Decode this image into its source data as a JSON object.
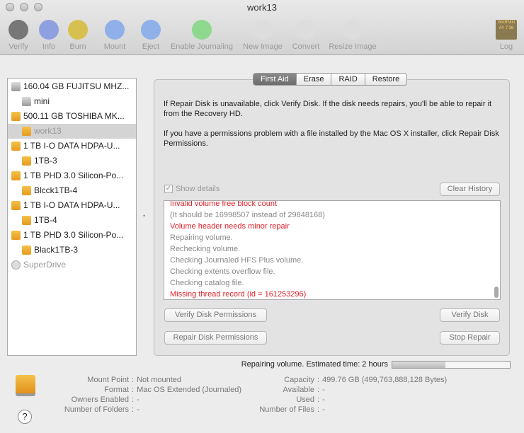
{
  "window": {
    "title": "work13"
  },
  "toolbar": {
    "items": [
      {
        "label": "Verify",
        "icon": "microscope-icon",
        "color": "#777"
      },
      {
        "label": "Info",
        "icon": "info-icon",
        "color": "#8fa0e0"
      },
      {
        "label": "Burn",
        "icon": "burn-icon",
        "color": "#d8c050"
      },
      {
        "label": "Mount",
        "icon": "mount-icon",
        "color": "#8fb0e8"
      },
      {
        "label": "Eject",
        "icon": "eject-icon",
        "color": "#8fb0e8"
      },
      {
        "label": "Enable Journaling",
        "icon": "journal-icon",
        "color": "#8fd88f"
      },
      {
        "label": "New Image",
        "icon": "new-image-icon",
        "color": "#ddd"
      },
      {
        "label": "Convert",
        "icon": "convert-icon",
        "color": "#ddd"
      },
      {
        "label": "Resize Image",
        "icon": "resize-image-icon",
        "color": "#ddd"
      }
    ],
    "log": {
      "label": "Log",
      "icon_text": "WARNIN\nAY 7:36"
    }
  },
  "sidebar": {
    "items": [
      {
        "label": "160.04 GB FUJITSU MHZ...",
        "level": 0,
        "icon": "g"
      },
      {
        "label": "mini",
        "level": 1,
        "icon": "g"
      },
      {
        "label": "500.11 GB TOSHIBA MK...",
        "level": 0,
        "icon": "o"
      },
      {
        "label": "work13",
        "level": 1,
        "icon": "o",
        "selected": true
      },
      {
        "label": "1 TB I-O DATA HDPA-U...",
        "level": 0,
        "icon": "o"
      },
      {
        "label": "1TB-3",
        "level": 1,
        "icon": "o"
      },
      {
        "label": "1 TB PHD 3.0 Silicon-Po...",
        "level": 0,
        "icon": "o"
      },
      {
        "label": "Blcck1TB-4",
        "level": 1,
        "icon": "o"
      },
      {
        "label": "1 TB I-O DATA HDPA-U...",
        "level": 0,
        "icon": "o"
      },
      {
        "label": "1TB-4",
        "level": 1,
        "icon": "o"
      },
      {
        "label": "1 TB PHD 3.0 Silicon-Po...",
        "level": 0,
        "icon": "o"
      },
      {
        "label": "Black1TB-3",
        "level": 1,
        "icon": "o"
      },
      {
        "label": "SuperDrive",
        "level": 0,
        "icon": "c",
        "dim": true
      }
    ]
  },
  "tabs": [
    "First Aid",
    "Erase",
    "RAID",
    "Restore"
  ],
  "first_aid": {
    "msg1": "If Repair Disk is unavailable, click Verify Disk. If the disk needs repairs, you'll be able to repair it from the Recovery HD.",
    "msg2": "If you have a permissions problem with a file installed by the Mac OS X installer, click Repair Disk Permissions.",
    "show_details": "Show details",
    "clear_history": "Clear History",
    "log": [
      {
        "text": "Invalid volume free block count",
        "error": true
      },
      {
        "text": "(It should be 16998507 instead of 29848168)",
        "error": false
      },
      {
        "text": "Volume header needs minor repair",
        "error": true
      },
      {
        "text": "Repairing volume.",
        "error": false
      },
      {
        "text": "Rechecking volume.",
        "error": false
      },
      {
        "text": "Checking Journaled HFS Plus volume.",
        "error": false
      },
      {
        "text": "Checking extents overflow file.",
        "error": false
      },
      {
        "text": "Checking catalog file.",
        "error": false
      },
      {
        "text": "Missing thread record (id = 161253296)",
        "error": true
      }
    ],
    "verify_perms": "Verify Disk Permissions",
    "repair_perms": "Repair Disk Permissions",
    "verify_disk": "Verify Disk",
    "stop_repair": "Stop Repair"
  },
  "status": {
    "text": "Repairing volume. Estimated time: 2 hours",
    "progress": 0.45
  },
  "info": {
    "left": [
      [
        "Mount Point",
        "Not mounted"
      ],
      [
        "Format",
        "Mac OS Extended (Journaled)"
      ],
      [
        "Owners Enabled",
        "-"
      ],
      [
        "Number of Folders",
        "-"
      ]
    ],
    "right": [
      [
        "Capacity",
        "499.76 GB (499,763,888,128 Bytes)"
      ],
      [
        "Available",
        "-"
      ],
      [
        "Used",
        "-"
      ],
      [
        "Number of Files",
        "-"
      ]
    ]
  },
  "help": "?"
}
